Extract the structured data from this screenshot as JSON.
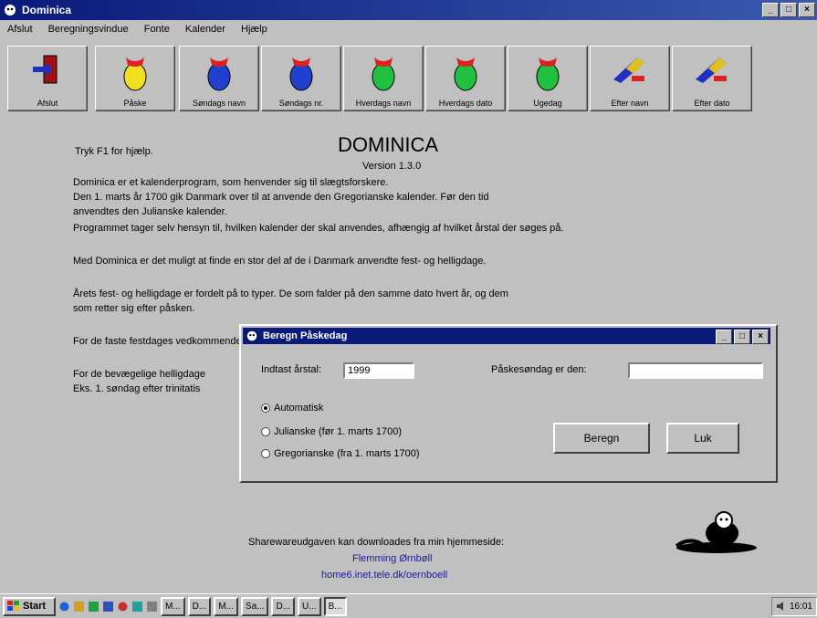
{
  "window": {
    "title": "Dominica",
    "min": "_",
    "max": "□",
    "close": "×"
  },
  "menu": [
    "Afslut",
    "Beregningsvindue",
    "Fonte",
    "Kalender",
    "Hjælp"
  ],
  "toolbar": [
    {
      "label": "Afslut",
      "icon": "exit-door-icon"
    },
    {
      "label": "Påske",
      "icon": "easter-egg-icon",
      "color": "#f0e020"
    },
    {
      "label": "Søndags navn",
      "icon": "easter-egg-icon",
      "color": "#2040d0"
    },
    {
      "label": "Søndags nr.",
      "icon": "easter-egg-icon",
      "color": "#2040d0"
    },
    {
      "label": "Hverdags navn",
      "icon": "easter-egg-icon",
      "color": "#20c040"
    },
    {
      "label": "Hverdags dato",
      "icon": "easter-egg-icon",
      "color": "#20c040"
    },
    {
      "label": "Ugedag",
      "icon": "easter-egg-icon",
      "color": "#20c040"
    },
    {
      "label": "Efter navn",
      "icon": "flag-pen-icon"
    },
    {
      "label": "Efter dato",
      "icon": "flag-pen-icon"
    }
  ],
  "main": {
    "help_hint": "Tryk F1 for hjælp.",
    "title": "DOMINICA",
    "version": "Version 1.3.0",
    "lines": [
      "Dominica er et kalenderprogram, som henvender sig til slægtsforskere.",
      "Den 1. marts år 1700 gik Danmark over til at anvende den Gregorianske kalender. Før den tid",
      "anvendtes den Julianske kalender.",
      "Programmet tager selv hensyn til, hvilken kalender der skal anvendes, afhængig af hvilket årstal der søges på.",
      "Med Dominica er det muligt at finde en stor del af de i Danmark anvendte fest- og helligdage.",
      "Årets fest- og helligdage er fordelt på to typer. De som falder på den samme dato hvert år, og dem",
      "som retter sig efter påsken.",
      "For de faste festdages vedkommende",
      "For de bevægelige helligdage",
      "Eks. 1. søndag efter trinitatis"
    ],
    "shareware": "Sharewareudgaven kan downloades fra min hjemmeside:",
    "author": "Flemming Ørnbøll",
    "url": "home6.inet.tele.dk/oernboell"
  },
  "dialog": {
    "title": "Beregn Påskedag",
    "year_label": "Indtast årstal:",
    "year_value": "1999",
    "result_label": "Påskesøndag er den:",
    "result_value": "",
    "radios": [
      {
        "label": "Automatisk",
        "checked": true
      },
      {
        "label": "Julianske (før 1. marts 1700)",
        "checked": false
      },
      {
        "label": "Gregorianske (fra 1. marts 1700)",
        "checked": false
      }
    ],
    "calc_button": "Beregn",
    "close_button": "Luk"
  },
  "taskbar": {
    "start": "Start",
    "tasks": [
      "M...",
      "D...",
      "M...",
      "Sa...",
      "D...",
      "U...",
      "B..."
    ],
    "clock": "16:01"
  }
}
